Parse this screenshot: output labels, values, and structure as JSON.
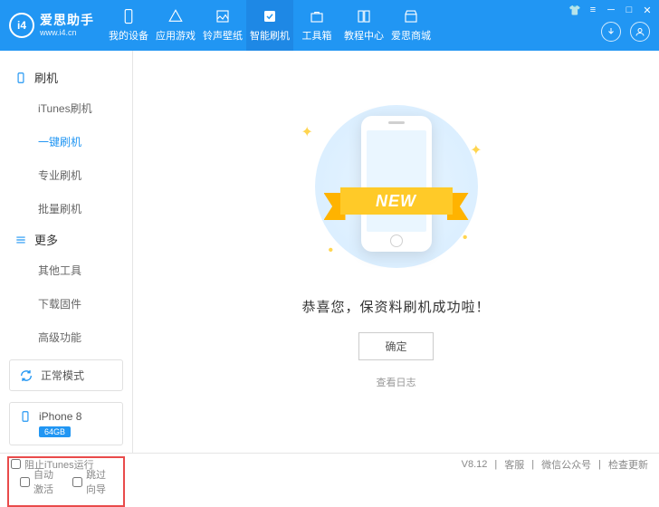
{
  "app": {
    "name": "爱思助手",
    "url": "www.i4.cn"
  },
  "nav": [
    {
      "label": "我的设备"
    },
    {
      "label": "应用游戏"
    },
    {
      "label": "铃声壁纸"
    },
    {
      "label": "智能刷机"
    },
    {
      "label": "工具箱"
    },
    {
      "label": "教程中心"
    },
    {
      "label": "爱思商城"
    }
  ],
  "sidebar": {
    "section1": "刷机",
    "items1": [
      "iTunes刷机",
      "一键刷机",
      "专业刷机",
      "批量刷机"
    ],
    "section2": "更多",
    "items2": [
      "其他工具",
      "下载固件",
      "高级功能"
    ],
    "mode": "正常模式",
    "device": "iPhone 8",
    "storage": "64GB",
    "auto_activate": "自动激活",
    "skip_guide": "跳过向导"
  },
  "main": {
    "ribbon": "NEW",
    "success": "恭喜您，保资料刷机成功啦！",
    "confirm": "确定",
    "log": "查看日志"
  },
  "footer": {
    "block_itunes": "阻止iTunes运行",
    "version": "V8.12",
    "support": "客服",
    "wechat": "微信公众号",
    "update": "检查更新"
  }
}
